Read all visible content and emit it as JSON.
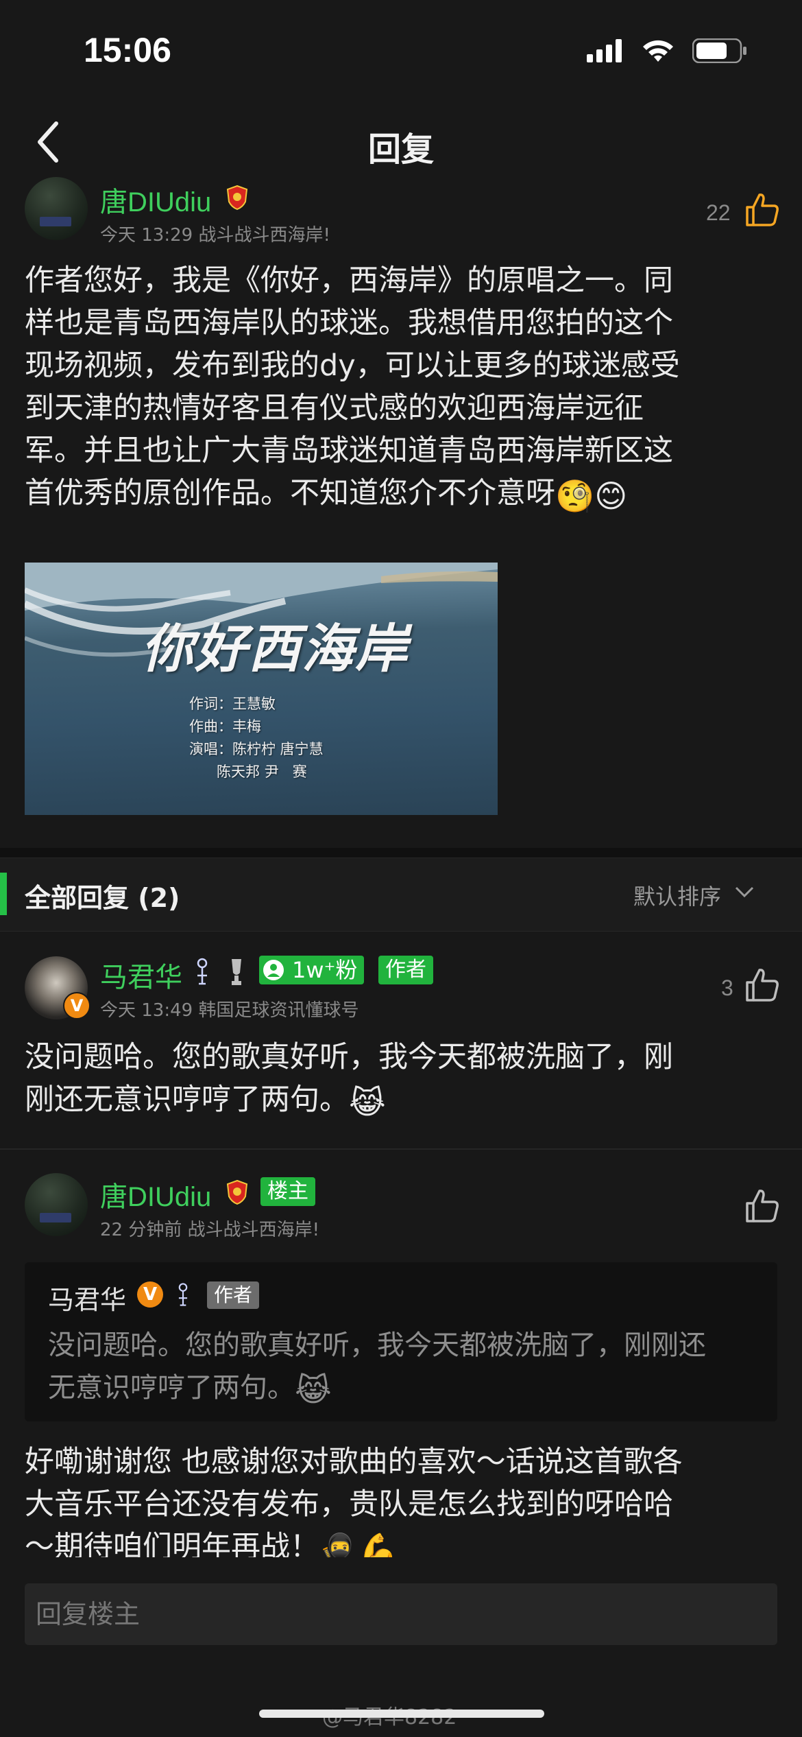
{
  "status_bar": {
    "time": "15:06"
  },
  "nav": {
    "title": "回复"
  },
  "main_comment": {
    "username": "唐DIUdiu",
    "time": "今天 13:29",
    "signature": "战斗战斗西海岸!",
    "like_count": "22",
    "text_lines": [
      "作者您好，我是《你好，西海岸》的原唱之一。同",
      "样也是青岛西海岸队的球迷。我想借用您拍的这个",
      "现场视频，发布到我的dy，可以让更多的球迷感受",
      "到天津的热情好客且有仪式感的欢迎西海岸远征",
      "军。并且也让广大青岛球迷知道青岛西海岸新区这",
      "首优秀的原创作品。不知道您介不介意呀"
    ],
    "emoji_tail": "🧐😊",
    "video": {
      "title": "你好西海岸",
      "credits": "作词：王慧敏\n作曲：丰梅\n演唱：陈柠柠 唐宁慧\n      陈天邦 尹   赛"
    }
  },
  "replies_header": {
    "title": "全部回复 (2)",
    "sort_label": "默认排序"
  },
  "reply1": {
    "username": "马君华",
    "fans_badge": "1w⁺粉",
    "author_tag": "作者",
    "time": "今天 13:49",
    "signature": "韩国足球资讯懂球号",
    "like_count": "3",
    "text_lines": [
      "没问题哈。您的歌真好听，我今天都被洗脑了，刚",
      "刚还无意识哼哼了两句。"
    ],
    "emoji_tail": "😹"
  },
  "reply2": {
    "username": "唐DIUdiu",
    "owner_tag": "楼主",
    "time": "22 分钟前",
    "signature": "战斗战斗西海岸!",
    "quote": {
      "username": "马君华",
      "author_tag": "作者",
      "text_lines": [
        "没问题哈。您的歌真好听，我今天都被洗脑了，刚刚还",
        "无意识哼哼了两句。"
      ],
      "emoji_tail": "😹"
    },
    "text_lines": [
      "好嘞谢谢您 也感谢您对歌曲的喜欢～话说这首歌各",
      "大音乐平台还没有发布，贵队是怎么找到的呀哈哈",
      "～期待咱们明年再战！"
    ],
    "emoji_tail": "🥷💪"
  },
  "reply_input": {
    "placeholder": "回复楼主"
  },
  "watermark": "@马君华8282",
  "colors": {
    "accent_green": "#3fcf5d",
    "tag_green": "#21b33d",
    "like_orange": "#f5a623",
    "background": "#181818"
  }
}
